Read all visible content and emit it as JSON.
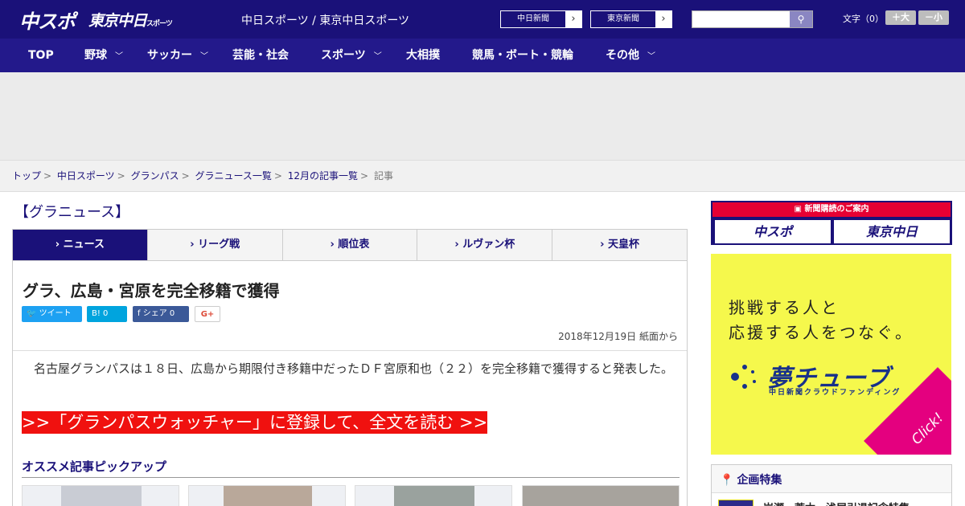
{
  "header": {
    "logo1": "中スポ",
    "logo2": "東京中日",
    "logo2_sub": "スポーツ",
    "site_name": "中日スポーツ / 東京中日スポーツ",
    "ext_links": [
      "中日新聞",
      "東京新聞"
    ],
    "search": {
      "placeholder": "",
      "value": ""
    },
    "fontsize_label": "文字（0）",
    "fontsize_buttons": [
      "＋大",
      "－小"
    ]
  },
  "nav": [
    {
      "label": "TOP"
    },
    {
      "label": "野球"
    },
    {
      "label": "サッカー"
    },
    {
      "label": "芸能・社会"
    },
    {
      "label": "スポーツ"
    },
    {
      "label": "大相撲"
    },
    {
      "label": "競馬・ボート・競輪"
    },
    {
      "label": "その他"
    }
  ],
  "breadcrumbs": [
    "トップ",
    "中日スポーツ",
    "グランパス",
    "グラニュース一覧",
    "12月の記事一覧",
    "記事"
  ],
  "section_title": "【グラニュース】",
  "tabs": [
    "› ニュース",
    "› リーグ戦",
    "› 順位表",
    "› ルヴァン杯",
    "› 天皇杯"
  ],
  "article": {
    "headline": "グラ、広島・宮原を完全移籍で獲得",
    "share": {
      "tweet": "ツイート",
      "hatena": "B! 0",
      "facebook": "シェア 0",
      "gplus": "G+"
    },
    "dateline": "2018年12月19日 紙面から",
    "body": "名古屋グランパスは１８日、広島から期限付き移籍中だったＤＦ宮原和也（２２）を完全移籍で獲得すると発表した。",
    "cta": ">>「グランパスウォッチャー」に登録して、全文を読む >>",
    "pickup_title": "オススメ記事ピックアップ"
  },
  "sidebar": {
    "sub_head": "新聞購読のご案内",
    "sub_logos": [
      "中スポ",
      "東京中日"
    ],
    "yume_text": [
      "挑戦する人と",
      "応援する人をつなぐ。"
    ],
    "yume_logo": "夢チューブ",
    "yume_sub": "中日新聞クラウドファンディング",
    "yume_click": "Click!",
    "feature_title": "企画特集",
    "feature_item": "岩瀬・荒木・浅尾引退記念特集"
  },
  "colors": {
    "brand": "#1a1179",
    "nav": "#23198b",
    "cta": "#f0110f",
    "yume_bg": "#f5f84c",
    "yume_accent": "#e4007f"
  }
}
